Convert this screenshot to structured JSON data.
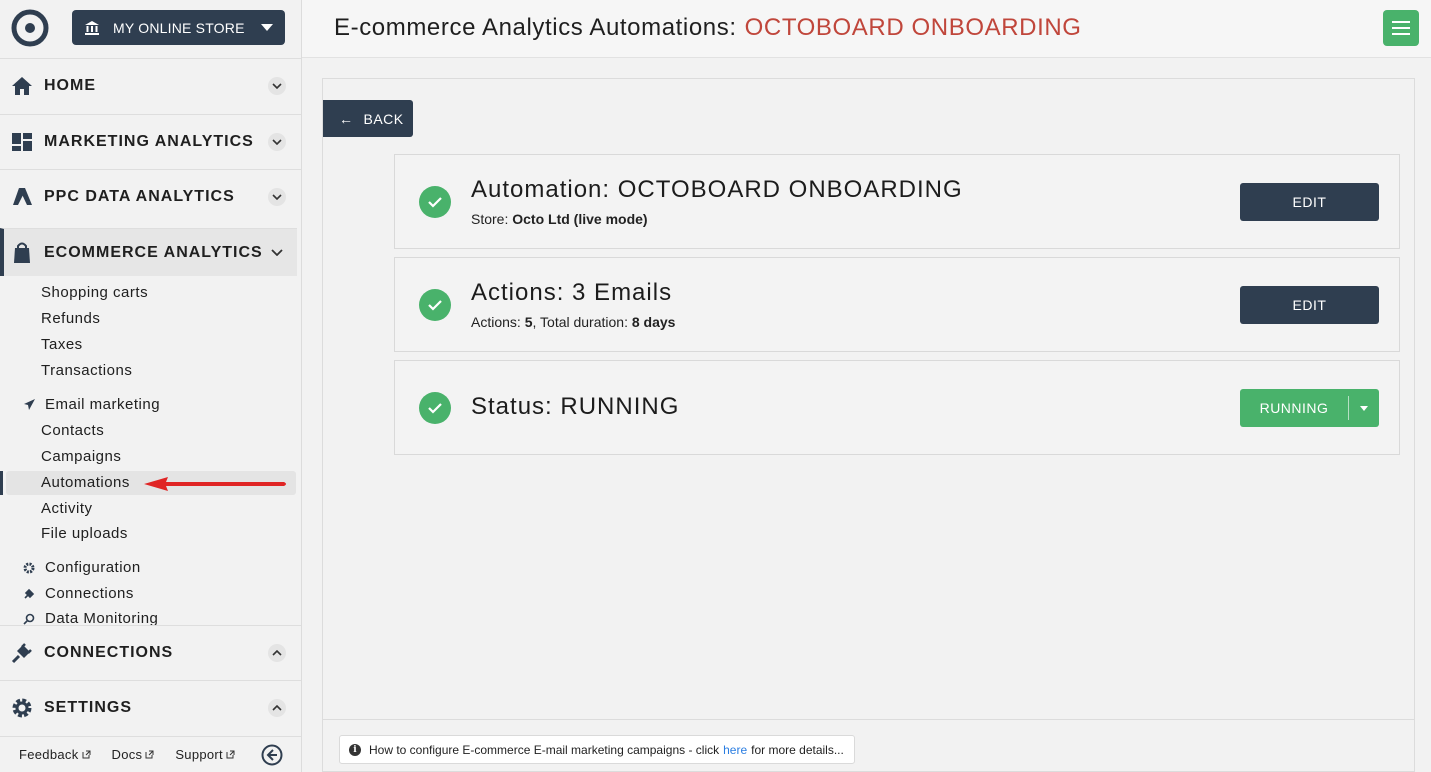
{
  "sidebar": {
    "store_selector": "MY ONLINE STORE",
    "sections": [
      {
        "label": "HOME",
        "icon": "home-icon"
      },
      {
        "label": "MARKETING ANALYTICS",
        "icon": "dashboard-icon"
      },
      {
        "label": "PPC DATA ANALYTICS",
        "icon": "ads-icon"
      },
      {
        "label": "ECOMMERCE ANALYTICS",
        "icon": "shopping-bag-icon"
      },
      {
        "label": "CONNECTIONS",
        "icon": "plug-icon"
      },
      {
        "label": "SETTINGS",
        "icon": "gear-icon"
      }
    ],
    "ecommerce_items": [
      "Shopping carts",
      "Refunds",
      "Taxes",
      "Transactions"
    ],
    "email_marketing": {
      "label": "Email marketing",
      "items": [
        "Contacts",
        "Campaigns",
        "Automations",
        "Activity",
        "File uploads"
      ]
    },
    "other_groups": [
      "Configuration",
      "Connections",
      "Data Monitoring"
    ],
    "bottom_links": [
      "Feedback",
      "Docs",
      "Support"
    ]
  },
  "header": {
    "title": "E-commerce Analytics Automations:",
    "title_accent": "OCTOBOARD ONBOARDING"
  },
  "main": {
    "back_label": "BACK",
    "cards": [
      {
        "title": "Automation: OCTOBOARD ONBOARDING",
        "sub_prefix": "Store:",
        "sub_value": "Octo Ltd (live mode)",
        "button": "EDIT"
      },
      {
        "title": "Actions: 3 Emails",
        "sub_actions_label": "Actions:",
        "sub_actions_value": "5",
        "sub_duration_label": ", Total duration:",
        "sub_duration_value": "8 days",
        "button": "EDIT"
      },
      {
        "title": "Status: RUNNING",
        "button": "RUNNING"
      }
    ],
    "help": {
      "before": "How to configure E-commerce E-mail marketing campaigns - click",
      "link": "here",
      "after": "for more details..."
    }
  },
  "colors": {
    "navy": "#2f3e50",
    "green": "#49b26b",
    "accent_red": "#c0463b",
    "link_blue": "#2a7de1"
  }
}
